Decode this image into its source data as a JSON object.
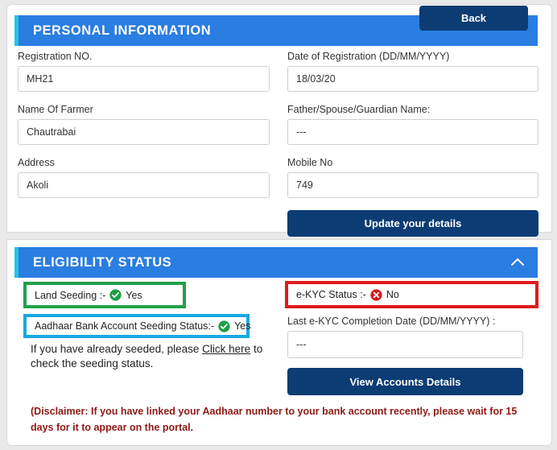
{
  "top_bar": {
    "back_label": "Back"
  },
  "personal_information": {
    "section_title": "PERSONAL INFORMATION",
    "fields": [
      {
        "label": "Registration NO.",
        "value": "MH21",
        "placeholder": ""
      },
      {
        "label": "Date of Registration (DD/MM/YYYY)",
        "value": "18/03/20",
        "placeholder": ""
      },
      {
        "label": "Name Of Farmer",
        "value": "Chautrabai",
        "placeholder": ""
      },
      {
        "label": "Father/Spouse/Guardian Name:",
        "value": "---",
        "placeholder": ""
      },
      {
        "label": "Address",
        "value": "Akoli",
        "placeholder": ""
      },
      {
        "label": "Mobile No",
        "value": "749",
        "placeholder": ""
      }
    ],
    "update_button_label": "Update your details"
  },
  "eligibility_status": {
    "section_title": "ELIGIBILITY STATUS",
    "collapse_icon": "chevron-up-icon",
    "land_seeding": {
      "label": "Land Seeding :-",
      "value": "Yes",
      "icon": "check-circle-icon",
      "icon_color": "#1d9e45",
      "box_border_color": "#22a14a"
    },
    "ekyc_status": {
      "label": "e-KYC Status :-",
      "value": "No",
      "icon": "cross-circle-icon",
      "icon_color": "#d41d1d",
      "box_border_color": "#e01b1b"
    },
    "aadhaar_bank_seeding": {
      "label": "Aadhaar Bank Account Seeding Status:-",
      "value": "Yes",
      "icon": "check-circle-icon",
      "icon_color": "#1d9e45",
      "box_border_color": "#19a8e0"
    },
    "seed_help": {
      "prefix": "If you have already seeded, please ",
      "link_text": "Click here",
      "suffix": " to check the seeding status."
    },
    "last_ekyc_date": {
      "label": "Last e-KYC Completion Date (DD/MM/YYYY) :",
      "value": "---",
      "placeholder": ""
    },
    "view_accounts_button_label": "View Accounts Details",
    "disclaimer": "(Disclaimer: If you have linked your Aadhaar number to your bank account recently, please wait for 15 days for it to appear on the portal."
  },
  "theme": {
    "header_blue": "#2a7de1",
    "header_accent_cyan": "#25c3e6",
    "navy_button": "#0c3c74",
    "page_background": "#e9e9e9",
    "disclaimer_red": "#8c1a14"
  }
}
